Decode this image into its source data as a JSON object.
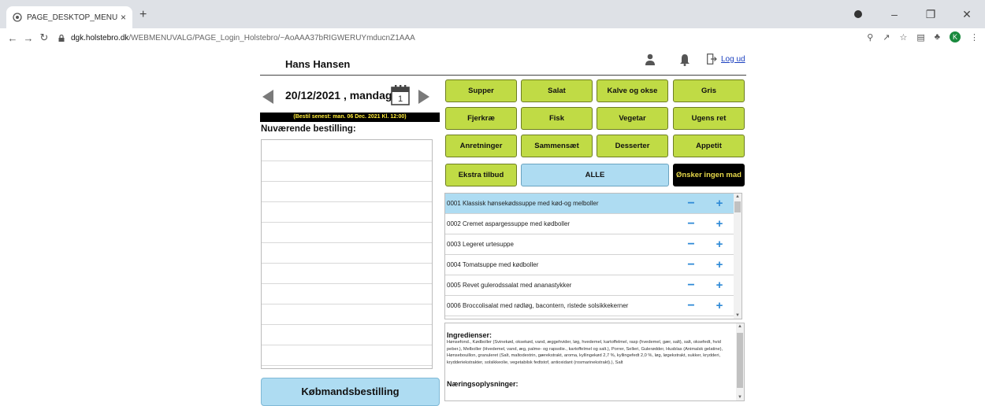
{
  "browser": {
    "tab_title": "PAGE_DESKTOP_MENUCHOICES",
    "tab_close": "×",
    "new_tab": "+",
    "url_host": "dgk.holstebro.dk",
    "url_path": "/WEBMENUVALG/PAGE_Login_Holstebro/~AoAAA37bRIGWERUYmducnZ1AAA",
    "profile_initial": "K",
    "colors": {
      "tabbar": "#dee1e6"
    }
  },
  "header": {
    "user_name": "Hans Hansen",
    "logout_label": "Log ud"
  },
  "date_nav": {
    "date_text": "20/12/2021 , mandag",
    "calendar_day": "1",
    "deadline_text": "(Bestil senest: man. 06 Dec. 2021 Kl. 12:00)"
  },
  "order": {
    "title": "Nuværende bestilling:",
    "merchant_button": "Købmandsbestilling"
  },
  "categories": [
    "Supper",
    "Salat",
    "Kalve og okse",
    "Gris",
    "Fjerkræ",
    "Fisk",
    "Vegetar",
    "Ugens ret",
    "Anretninger",
    "Sammensæt",
    "Desserter",
    "Appetit",
    "Ekstra tilbud",
    "ALLE",
    "Ønsker ingen mad"
  ],
  "dishes": [
    {
      "name": "0001 Klassisk hønsekødssuppe med kød-og melboller",
      "selected": true
    },
    {
      "name": "0002 Cremet aspargessuppe med kødboller",
      "selected": false
    },
    {
      "name": "0003 Legeret urtesuppe",
      "selected": false
    },
    {
      "name": "0004 Tomatsuppe med kødboller",
      "selected": false
    },
    {
      "name": "0005 Revet gulerodssalat med ananastykker",
      "selected": false
    },
    {
      "name": "0006 Broccolisalat med rødløg, bacontern, ristede solsikkekerner",
      "selected": false
    }
  ],
  "dish_controls": {
    "minus": "−",
    "plus": "+"
  },
  "info": {
    "ingredients_title": "Ingredienser:",
    "ingredients_text": "Hønsefond., Kødboller (Svinekød, oksekød, vand, æggehvider, løg, hvedemel, kartoffelmel, rasp (hvedemel, gær, salt), salt, oksefedt, hvid peber.), Melboller (Hvedemel, vand, æg, palme- og rapsolie., kartoffelmel og salt.), Porrer, Selleri, Gulerødder, Husblas (Animalsk gelatine), Hønsebouillon, granuleret (Salt, maltodextrin, gærekstrakt, aroma, kyllingekød 2,7 %, kyllingefedt 2,0 %, løg, løgekstrakt, sukker, krydderi, krydderiekstrakter, solsikkeolie, vegetabilsk fedtstof, antioxidant (rosmarinekstrakt).), Salt",
    "nutrition_title": "Næringsoplysninger:"
  }
}
